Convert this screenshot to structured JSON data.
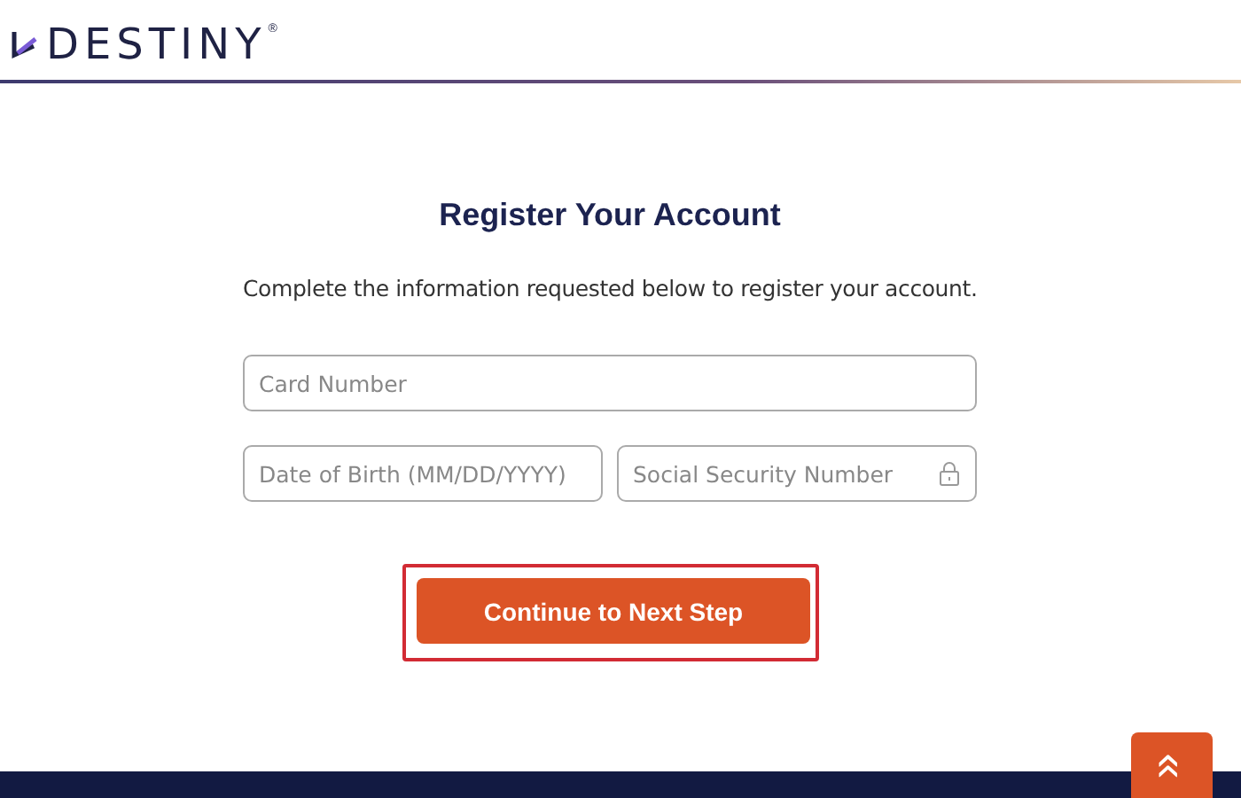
{
  "header": {
    "logo_text": "DESTINY",
    "registered_mark": "®"
  },
  "form": {
    "title": "Register Your Account",
    "description": "Complete the information requested below to register your account.",
    "fields": [
      {
        "placeholder": "Card Number",
        "kind": "text"
      },
      {
        "placeholder": "Date of Birth (MM/DD/YYYY)",
        "kind": "text"
      },
      {
        "placeholder": "Social Security Number",
        "kind": "secure"
      }
    ],
    "submit": {
      "label": "Continue to Next Step",
      "highlighted": true
    }
  },
  "scroll_top": {
    "label": "«"
  }
}
